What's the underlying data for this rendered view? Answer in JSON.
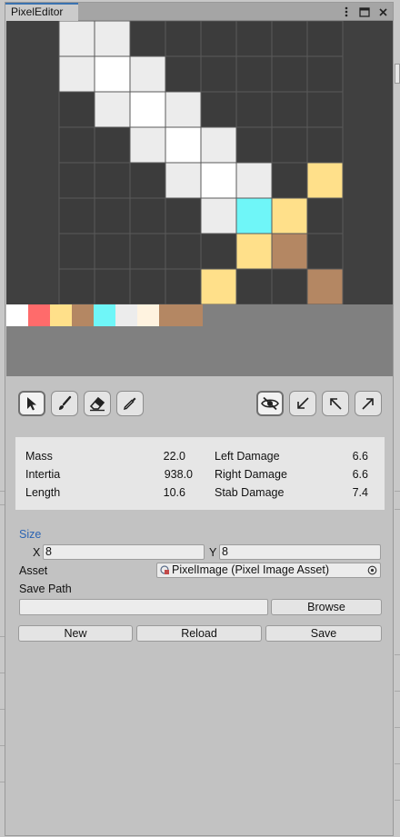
{
  "window": {
    "tab_title": "PixelEditor"
  },
  "canvas": {
    "grid_cols": 8,
    "grid_rows": 8,
    "pixels": [
      [
        "#ececec",
        "#ececec",
        "",
        "",
        "",
        "",
        "",
        ""
      ],
      [
        "#ececec",
        "#ffffff",
        "#ececec",
        "",
        "",
        "",
        "",
        ""
      ],
      [
        "",
        "#ececec",
        "#ffffff",
        "#ececec",
        "",
        "",
        "",
        ""
      ],
      [
        "",
        "",
        "#ececec",
        "#ffffff",
        "#ececec",
        "",
        "",
        ""
      ],
      [
        "",
        "",
        "",
        "#ececec",
        "#ffffff",
        "#ececec",
        "",
        "#ffe08a"
      ],
      [
        "",
        "",
        "",
        "",
        "#ececec",
        "#6ff6f8",
        "#ffe08a",
        ""
      ],
      [
        "",
        "",
        "",
        "",
        "",
        "#ffe08a",
        "#b48763",
        ""
      ],
      [
        "",
        "",
        "",
        "",
        "#ffe08a",
        "",
        "",
        "#b48763"
      ]
    ],
    "palette": [
      "#ffffff",
      "#ff6b6b",
      "#ffe08a",
      "#b48763",
      "#6ff6f8",
      "#ececec",
      "#fff3e0",
      "#b48763"
    ],
    "colors": {
      "grid_bg": "#404040",
      "grid_line": "#5a5a5a",
      "empty": "#3c3c3c",
      "canvas_bg": "#808080"
    }
  },
  "tools": {
    "left": [
      {
        "name": "select-tool",
        "icon": "pointer-icon"
      },
      {
        "name": "brush-tool",
        "icon": "brush-icon"
      },
      {
        "name": "eraser-tool",
        "icon": "eraser-icon"
      },
      {
        "name": "eyedropper-tool",
        "icon": "eyedropper-icon"
      }
    ],
    "right": [
      {
        "name": "visibility-toggle",
        "icon": "eye-hidden-icon"
      },
      {
        "name": "arrow-down-left",
        "icon": "arrow-down-left-icon"
      },
      {
        "name": "arrow-up-left",
        "icon": "arrow-up-left-icon"
      },
      {
        "name": "arrow-up-right",
        "icon": "arrow-up-right-icon"
      }
    ]
  },
  "stats": {
    "mass_label": "Mass",
    "mass_value": "22.0",
    "inertia_label": "Intertia",
    "inertia_value": "938.0",
    "length_label": "Length",
    "length_value": "10.6",
    "left_damage_label": "Left Damage",
    "left_damage_value": "6.6",
    "right_damage_label": "Right Damage",
    "right_damage_value": "6.6",
    "stab_damage_label": "Stab Damage",
    "stab_damage_value": "7.4"
  },
  "form": {
    "size_label": "Size",
    "x_label": "X",
    "x_value": "8",
    "y_label": "Y",
    "y_value": "8",
    "asset_label": "Asset",
    "asset_value": "PixelImage (Pixel Image Asset)",
    "save_path_label": "Save Path",
    "save_path_value": "",
    "browse_label": "Browse",
    "new_label": "New",
    "reload_label": "Reload",
    "save_label": "Save"
  }
}
